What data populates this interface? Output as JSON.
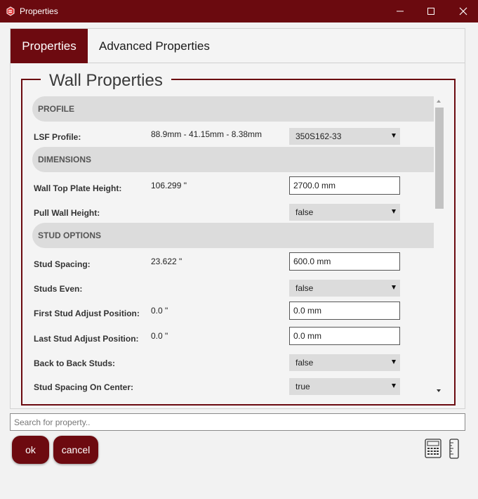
{
  "window": {
    "title": "Properties",
    "controls": [
      "minimize",
      "maximize",
      "close"
    ],
    "accent_color": "#6b0a10"
  },
  "tabs": [
    {
      "label": "Properties",
      "active": true
    },
    {
      "label": "Advanced Properties",
      "active": false
    }
  ],
  "group": {
    "title": "Wall Properties"
  },
  "sections": {
    "profile": "PROFILE",
    "dimensions": "DIMENSIONS",
    "stud_options": "STUD OPTIONS"
  },
  "properties": {
    "lsf_profile": {
      "label": "LSF Profile:",
      "info": "88.9mm - 41.15mm - 8.38mm",
      "value": "350S162-33"
    },
    "wall_top_plate_height": {
      "label": "Wall Top Plate Height:",
      "info": "106.299 \"",
      "value": "2700.0 mm"
    },
    "pull_wall_height": {
      "label": "Pull Wall Height:",
      "value": "false"
    },
    "stud_spacing": {
      "label": "Stud Spacing:",
      "info": "23.622 \"",
      "value": "600.0 mm"
    },
    "studs_even": {
      "label": "Studs Even:",
      "value": "false"
    },
    "first_stud_adjust": {
      "label": "First Stud Adjust Position:",
      "info": "0.0 \"",
      "value": "0.0 mm"
    },
    "last_stud_adjust": {
      "label": "Last Stud Adjust Position:",
      "info": "0.0 \"",
      "value": "0.0 mm"
    },
    "back_to_back_studs": {
      "label": "Back to Back Studs:",
      "value": "false"
    },
    "stud_spacing_on_center": {
      "label": "Stud Spacing On Center:",
      "value": "true"
    }
  },
  "search": {
    "placeholder": "Search for property.."
  },
  "buttons": {
    "ok": "ok",
    "cancel": "cancel"
  },
  "icons": [
    "calculator-icon",
    "ruler-icon"
  ]
}
